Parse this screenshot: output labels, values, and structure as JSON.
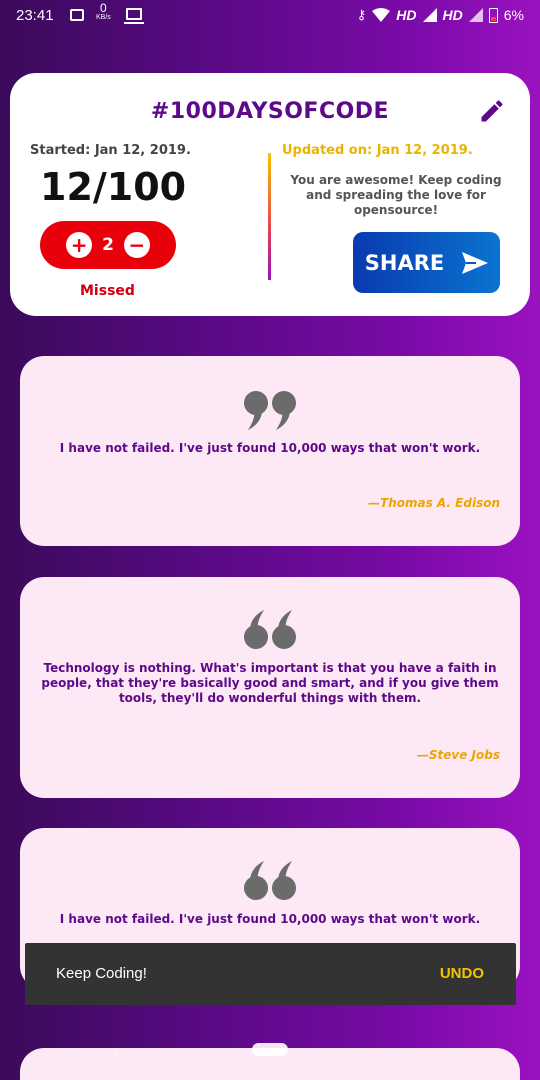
{
  "status_bar": {
    "time": "23:41",
    "net_speed": "0",
    "net_unit": "KB/s",
    "network_1": "HD",
    "network_2": "HD",
    "battery": "6%",
    "icons": [
      "image-icon",
      "monitor-icon",
      "key-icon",
      "wifi-icon",
      "signal-icon",
      "battery-icon"
    ]
  },
  "header": {
    "title": "#100DAYSOFCODE",
    "edit_icon": "pencil-icon"
  },
  "progress": {
    "started_label": "Started: Jan 12, 2019.",
    "count_text": "12/100",
    "missed_count": "2",
    "missed_label": "Missed",
    "updated_label": "Updated on: Jan 12, 2019.",
    "message": "You are awesome! Keep coding and spreading the love for opensource!",
    "share_label": "SHARE",
    "stepper_color": "#e8000b"
  },
  "quotes": [
    {
      "text": "I have not failed. I've just found 10,000 ways that won't work.",
      "author": "—Thomas A. Edison"
    },
    {
      "text": "Technology is nothing. What's important is that you have a faith in people, that they're basically good and smart, and if you give them tools, they'll do wonderful things with them.",
      "author": "—Steve Jobs"
    },
    {
      "text": "I have not failed. I've just found 10,000 ways that won't work.",
      "author": ""
    }
  ],
  "snackbar": {
    "message": "Keep Coding!",
    "action": "UNDO"
  },
  "colors": {
    "accent_purple": "#5c0a8a",
    "accent_yellow": "#f5c400",
    "share_blue": "#0a3ab0"
  }
}
